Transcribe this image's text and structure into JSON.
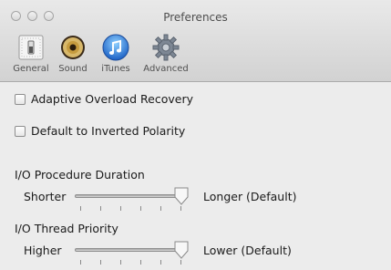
{
  "window": {
    "title": "Preferences"
  },
  "toolbar": {
    "tabs": [
      {
        "label": "General",
        "icon": "general-switch-icon"
      },
      {
        "label": "Sound",
        "icon": "speaker-icon"
      },
      {
        "label": "iTunes",
        "icon": "itunes-note-icon"
      },
      {
        "label": "Advanced",
        "icon": "gear-icon"
      }
    ]
  },
  "options": {
    "adaptive_label": "Adaptive Overload Recovery",
    "adaptive_checked": false,
    "inverted_label": "Default to Inverted Polarity",
    "inverted_checked": false
  },
  "duration": {
    "heading": "I/O Procedure Duration",
    "low_label": "Shorter",
    "high_label": "Longer (Default)",
    "value_fraction": 1.0
  },
  "priority": {
    "heading": "I/O Thread Priority",
    "low_label": "Higher",
    "high_label": "Lower (Default)",
    "value_fraction": 1.0
  }
}
